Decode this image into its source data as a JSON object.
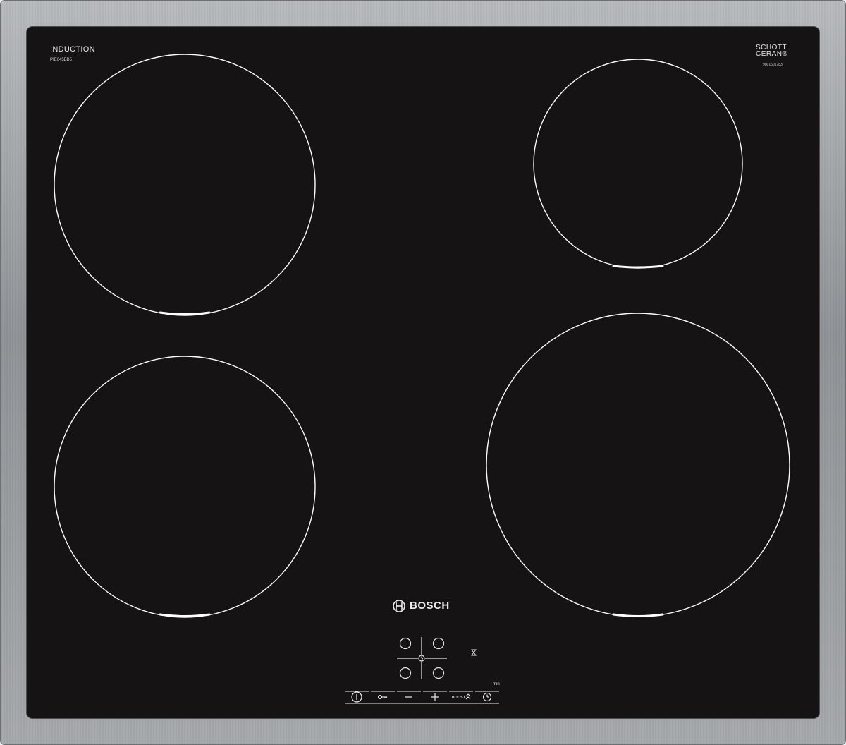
{
  "product": {
    "type_label": "INDUCTION",
    "model_number": "PIE645BB5",
    "glass_brand_line1": "SCHOTT",
    "glass_brand_line2": "CERAN®",
    "serial_number": "9001601783",
    "brand_name": "BOSCH"
  },
  "zones": [
    {
      "name": "front-left",
      "label": ""
    },
    {
      "name": "rear-left",
      "label": ""
    },
    {
      "name": "rear-right",
      "label": ""
    },
    {
      "name": "front-right",
      "label": ""
    }
  ],
  "controls": {
    "icons": [
      "power-icon",
      "key-lock-icon",
      "minus-icon",
      "plus-icon",
      "boost-icon",
      "timer-icon"
    ],
    "boost_label": "BOOST",
    "timer_unit_label": "min"
  },
  "colors": {
    "glass": "#151313",
    "frame": "#a2a5a8",
    "markings": "#ffffff"
  }
}
